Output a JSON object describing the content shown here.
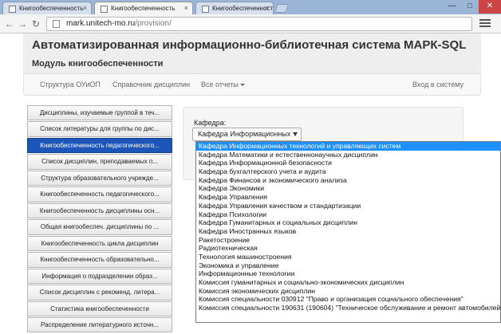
{
  "browser": {
    "tabs": [
      {
        "label": "Книгообеспеченность",
        "active": false
      },
      {
        "label": "Книгообеспеченность",
        "active": true
      },
      {
        "label": "Книгообеспеченность",
        "active": false
      }
    ],
    "close_glyph": "×",
    "url_host": "mark.unitech-mo.ru",
    "url_path": "/provision/",
    "window_controls": [
      "—",
      "□",
      "✕"
    ]
  },
  "header": {
    "title": "Автоматизированная информационно-библиотечная система МАРК-SQL",
    "subtitle": "Модуль книгообеспеченности"
  },
  "topnav": {
    "items": [
      "Структура ОУиОП",
      "Справочник дисциплин",
      "Все отчеты"
    ],
    "login": "Вход в систему"
  },
  "sidebar": {
    "items": [
      "Дисциплины, изучаемые группой в теч...",
      "Список литературы для группы по дис...",
      "Книгообеспеченность педагогического...",
      "Список дисциплин, преподаваемых п...",
      "Структура образовательного учрежде...",
      "Книгообеспеченность педагогического...",
      "Книгообеспеченность дисциплины осн...",
      "Общая книгообеспеч. дисциплины по ...",
      "Книгообеспеченность цикла дисциплин",
      "Книгообеспеченность образовательно...",
      "Информация о подразделении образ...",
      "Список дисциплин с рекоменд. литера...",
      "Статистика книгообеспеченности",
      "Распределение литературного источн..."
    ],
    "active_index": 2
  },
  "form": {
    "label": "Кафедра:",
    "selected_display": "Кафедра Информационных",
    "options": [
      "Кафедра Информационных технологий и управляющих систем",
      "Кафедра Математики и естественнонаучных дисциплин",
      "Кафедра Информационной безопасности",
      "Кафедра бухгалтерского учета и аудита",
      "Кафедра Финансов и экономического анализа",
      "Кафедра Экономики",
      "Кафедра Управления",
      "Кафедра Управления качеством и стандартизации",
      "Кафедра Психологии",
      "Кафедра Гуманитарных и социальных дисциплин",
      "Кафедра Иностранных языков",
      "Ракетостроение",
      "Радиотехническая",
      "Технология машиностроения",
      "Экономика и управление",
      "Информационные технологии",
      "Комиссия гуманитарных и социально-экономических дисциплин",
      "Комиссия экономических дисциплин",
      "Комиссия специальности 030912 \"Право и организация социального обеспечения\"",
      "Комиссия специальности 190631 (190604) \"Техническое обслуживание и ремонт автомобилей\""
    ],
    "selected_index": 0
  }
}
